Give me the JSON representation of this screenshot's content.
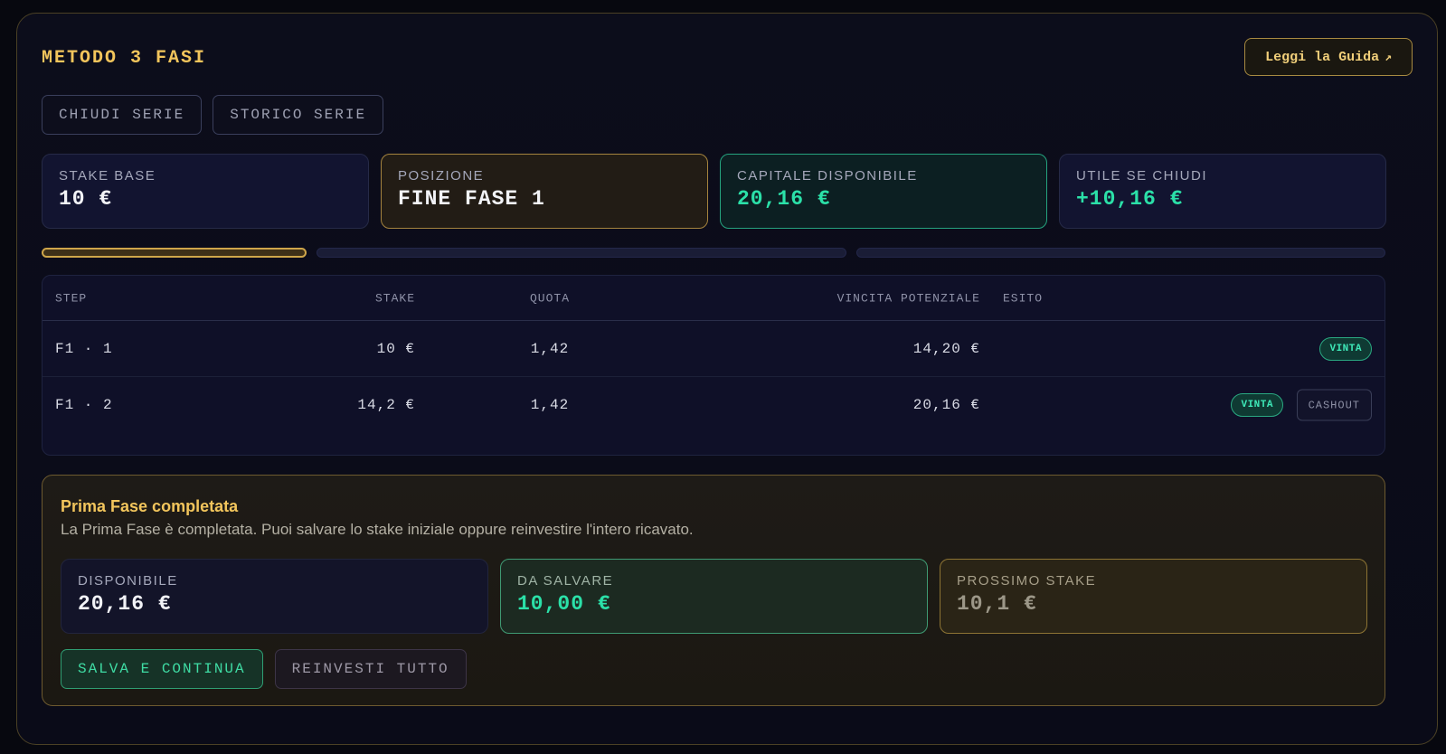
{
  "header": {
    "title": "METODO 3 FASI",
    "guide_button": "Leggi la Guida",
    "guide_icon": "external-arrow-icon"
  },
  "toolbar": {
    "close_series": "CHIUDI SERIE",
    "series_history": "STORICO SERIE"
  },
  "stats": [
    {
      "label": "STAKE BASE",
      "value": "10 €"
    },
    {
      "label": "POSIZIONE",
      "value": "FINE FASE 1"
    },
    {
      "label": "CAPITALE DISPONIBILE",
      "value": "20,16 €"
    },
    {
      "label": "UTILE SE CHIUDI",
      "value": "+10,16 €"
    }
  ],
  "progress": {
    "phases_total": 3,
    "current_phase": 1
  },
  "table": {
    "columns": {
      "step": "STEP",
      "stake": "STAKE",
      "quota": "QUOTA",
      "vincita": "VINCITA POTENZIALE",
      "esito": "ESITO"
    },
    "rows": [
      {
        "step": "F1 · 1",
        "stake": "10 €",
        "quota": "1,42",
        "vincita": "14,20 €",
        "esito": "VINTA"
      },
      {
        "step": "F1 · 2",
        "stake": "14,2 €",
        "quota": "1,42",
        "vincita": "20,16 €",
        "esito": "VINTA",
        "action": "CASHOUT"
      }
    ]
  },
  "phase": {
    "title": "Prima Fase completata",
    "description": "La Prima Fase è completata. Puoi salvare lo stake iniziale oppure reinvestire l'intero ricavato.",
    "boxes": [
      {
        "label": "DISPONIBILE",
        "value": "20,16 €"
      },
      {
        "label": "DA SALVARE",
        "value": "10,00 €"
      },
      {
        "label": "PROSSIMO STAKE",
        "value": "10,1 €"
      }
    ],
    "save_continue": "SALVA E CONTINUA",
    "reinvest_all": "REINVESTI TUTTO"
  },
  "colors": {
    "gold": "#f2c55c",
    "green": "#2be0a8",
    "background": "#07080f"
  }
}
